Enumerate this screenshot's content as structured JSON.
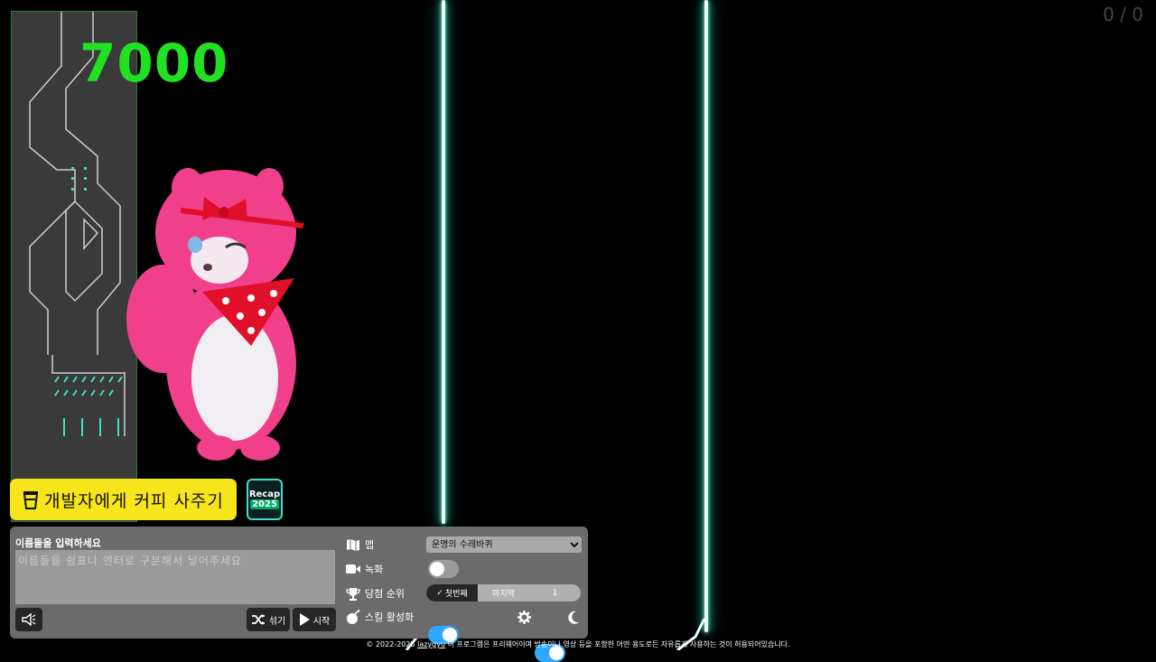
{
  "score": "7000",
  "counter": "0 / 0",
  "coffee_button": {
    "label": "개발자에게 커피 사주기"
  },
  "recap_button": {
    "line1": "Recap",
    "line2": "2025"
  },
  "names": {
    "title": "이름들을 입력하세요",
    "placeholder": "이름들을 쉼표나 엔터로 구분해서 넣어주세요",
    "value": ""
  },
  "buttons": {
    "shuffle": "섞기",
    "start": "시작"
  },
  "settings": {
    "map_label": "맵",
    "map_selected": "운명의 수레바퀴",
    "recording_label": "녹화",
    "recording_on": false,
    "rank_label": "당첨 순위",
    "rank_first": "첫번째",
    "rank_last": "마지막",
    "rank_count": "1",
    "skill_label": "스킬 활성화",
    "skill_on": true,
    "theme_dark": true
  },
  "footer": {
    "prefix": "© 2022-2025 ",
    "link": "lazygyu",
    "suffix": " 이 프로그램은 프리웨어이며 방송이나 영상 등을 포함한 어떤 용도로든 자유롭게 사용하는 것이 허용되어있습니다."
  },
  "colors": {
    "score": "#22e022",
    "neon": "#3de0c0",
    "coffee": "#f6e51a",
    "toggle_on": "#2fa8ff"
  },
  "icons": [
    "coffee-icon",
    "map-icon",
    "video-icon",
    "trophy-icon",
    "bomb-icon",
    "gear-icon",
    "moon-icon",
    "speaker-icon",
    "shuffle-icon",
    "play-icon",
    "check-icon"
  ]
}
